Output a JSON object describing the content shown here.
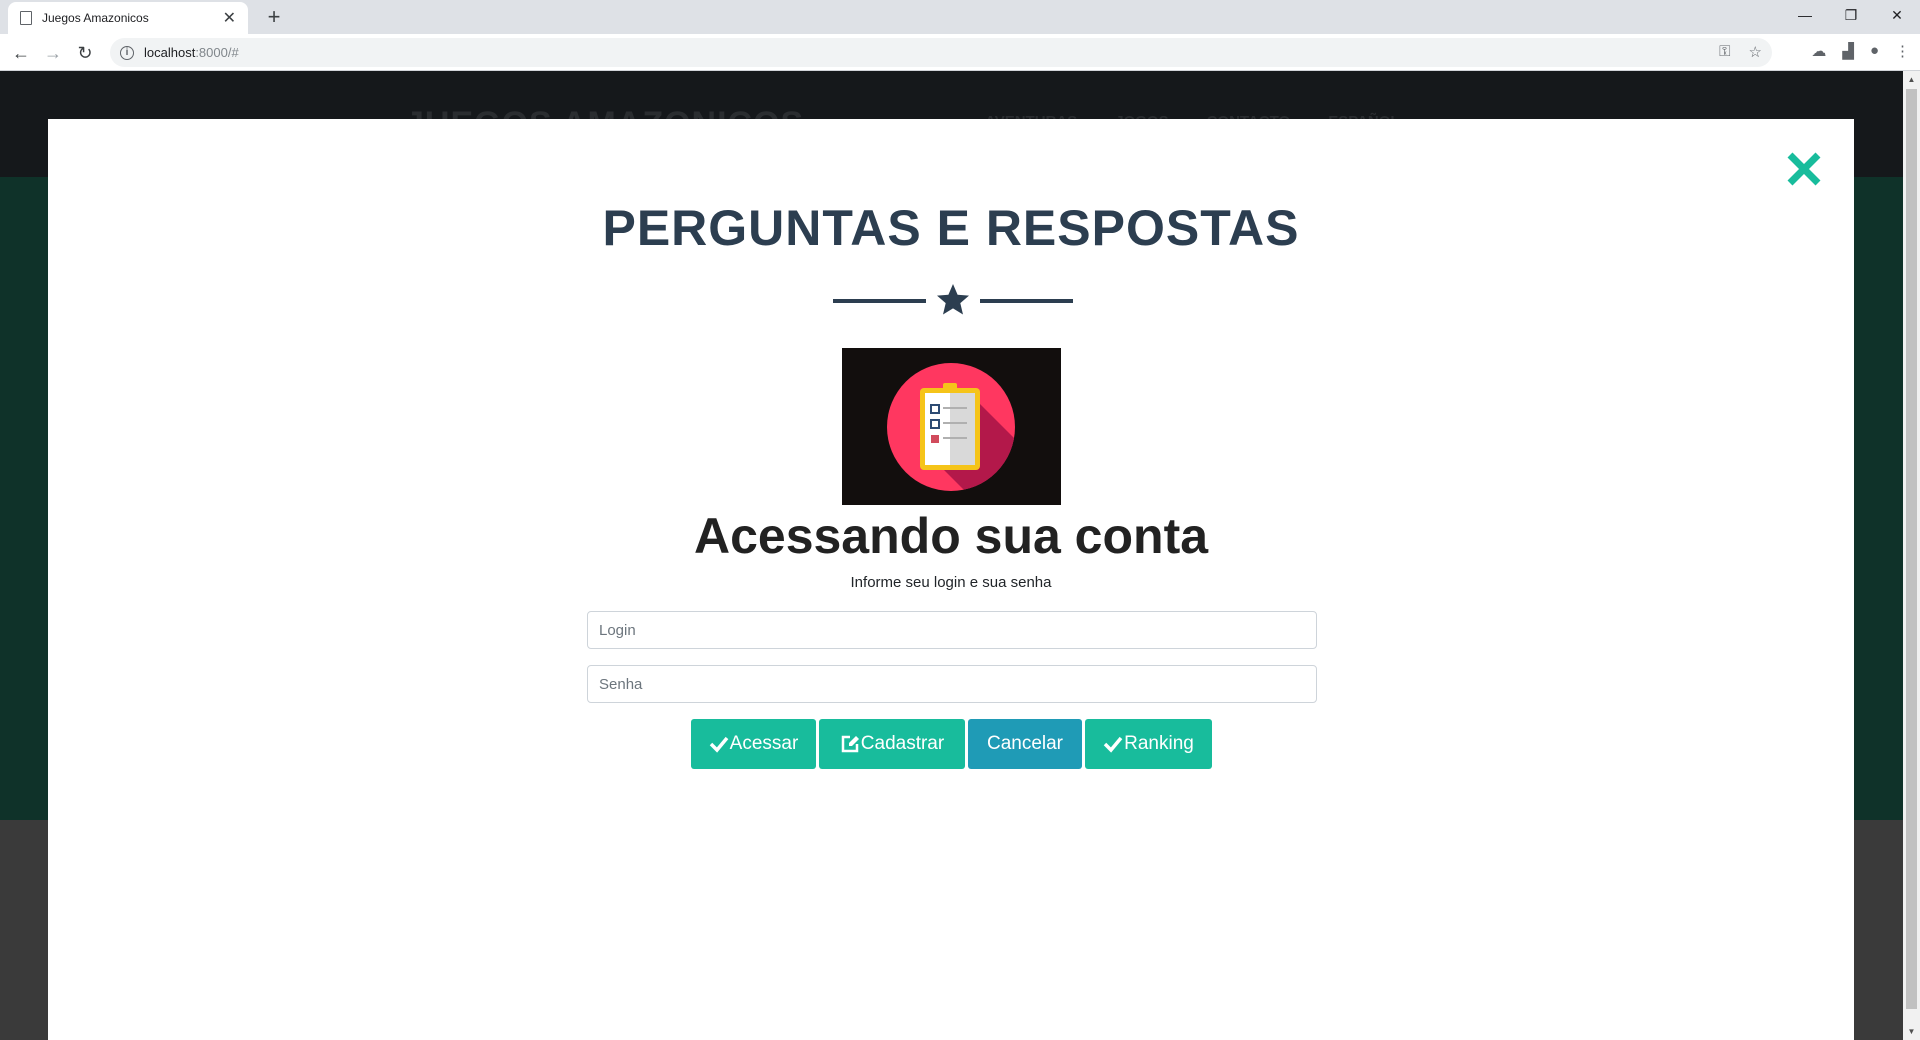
{
  "browser": {
    "tab_title": "Juegos Amazonicos",
    "url_host": "localhost",
    "url_path": ":8000/#"
  },
  "page": {
    "brand": "JUEGOS AMAZONICOS",
    "nav": [
      "AVENTURAS",
      "JOGOS",
      "CONTACTO",
      "ESPAÑOL"
    ]
  },
  "modal": {
    "title": "PERGUNTAS E RESPOSTAS",
    "heading": "Acessando sua conta",
    "subtitle": "Informe seu login e sua senha",
    "login_placeholder": "Login",
    "senha_placeholder": "Senha",
    "buttons": {
      "acessar": "Acessar",
      "cadastrar": "Cadastrar",
      "cancelar": "Cancelar",
      "ranking": "Ranking"
    }
  },
  "colors": {
    "primary": "#2c3e50",
    "accent": "#18bc9c",
    "info": "#1f9bb6",
    "quiz_circle": "#ff3760"
  },
  "icons": [
    "document-icon",
    "close-icon",
    "plus-icon",
    "back-icon",
    "forward-icon",
    "reload-icon",
    "info-icon",
    "key-icon",
    "star-icon",
    "check-icon",
    "edit-icon",
    "clipboard-icon"
  ]
}
